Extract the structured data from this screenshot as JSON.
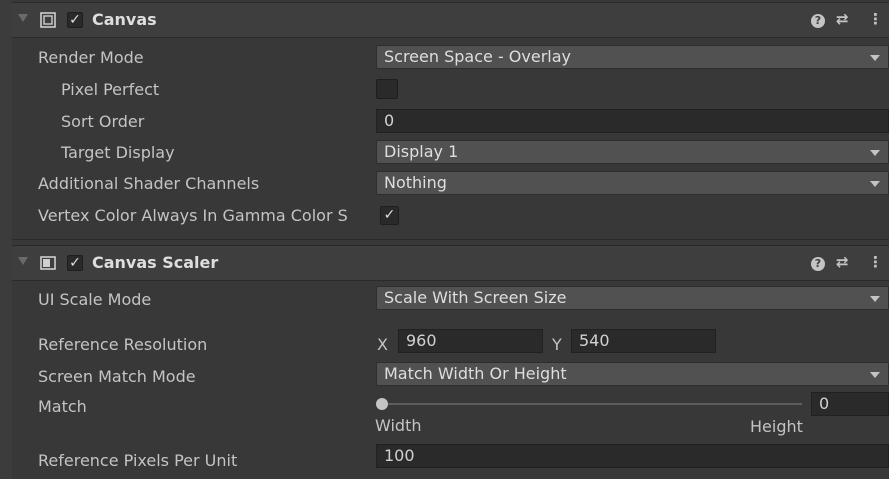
{
  "canvas": {
    "title": "Canvas",
    "enabled_mark": "✓",
    "help_glyph": "?",
    "preset_glyph": "⇄",
    "menu_glyph": "⋮",
    "render_mode_label": "Render Mode",
    "render_mode_value": "Screen Space - Overlay",
    "pixel_perfect_label": "Pixel Perfect",
    "pixel_perfect_checked": false,
    "sort_order_label": "Sort Order",
    "sort_order_value": "0",
    "target_display_label": "Target Display",
    "target_display_value": "Display 1",
    "shader_channels_label": "Additional Shader Channels",
    "shader_channels_value": "Nothing",
    "vertex_color_label": "Vertex Color Always In Gamma Color S",
    "vertex_color_mark": "✓"
  },
  "canvas_scaler": {
    "title": "Canvas Scaler",
    "enabled_mark": "✓",
    "help_glyph": "?",
    "preset_glyph": "⇄",
    "menu_glyph": "⋮",
    "ui_scale_mode_label": "UI Scale Mode",
    "ui_scale_mode_value": "Scale With Screen Size",
    "reference_resolution_label": "Reference Resolution",
    "x_label": "X",
    "x_value": "960",
    "y_label": "Y",
    "y_value": "540",
    "screen_match_mode_label": "Screen Match Mode",
    "screen_match_mode_value": "Match Width Or Height",
    "match_label": "Match",
    "match_value": "0",
    "match_fraction": 0,
    "width_label": "Width",
    "height_label": "Height",
    "ref_pixels_label": "Reference Pixels Per Unit",
    "ref_pixels_value": "100"
  },
  "colors": {
    "background": "#383838",
    "header": "#3e3e3e",
    "field": "#2a2a2a",
    "dropdown": "#515151"
  }
}
